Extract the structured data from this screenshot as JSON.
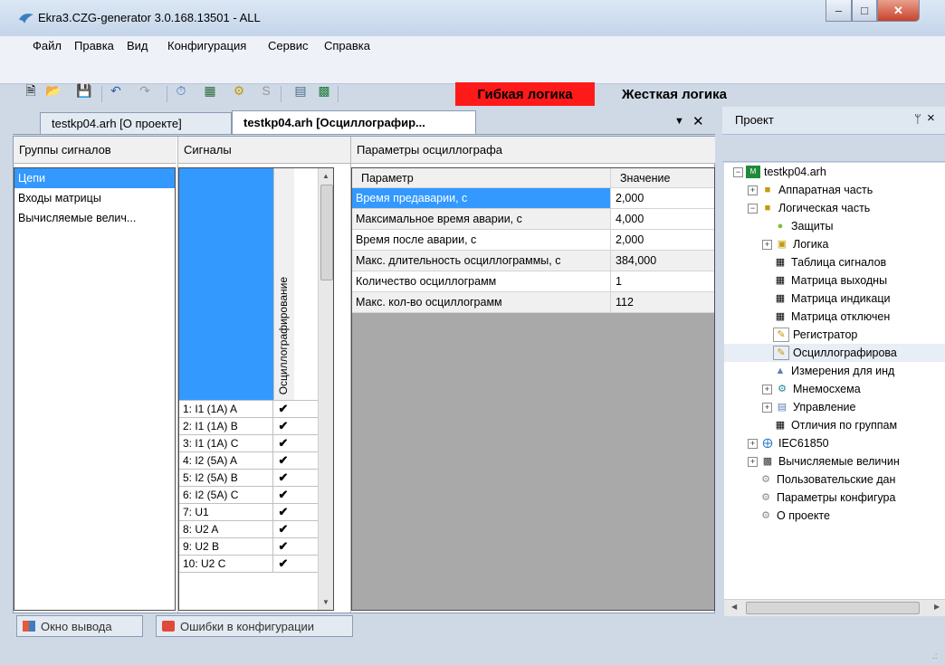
{
  "window": {
    "title": "Ekra3.CZG-generator 3.0.168.13501 - ALL"
  },
  "menu": [
    "Файл",
    "Правка",
    "Вид",
    "Конфигурация",
    "Сервис",
    "Справка"
  ],
  "toolbar": {
    "flex_logic": "Гибкая логика",
    "hard_logic": "Жесткая логика",
    "colors": {
      "flex_bg": "#ff1a1a"
    }
  },
  "tabs": [
    {
      "label": "testkp04.arh [О проекте]"
    },
    {
      "label": "testkp04.arh [Осциллографир..."
    }
  ],
  "groups": {
    "header": "Группы сигналов",
    "items": [
      "Цепи",
      "Входы матрицы",
      "Вычисляемые велич..."
    ]
  },
  "signals": {
    "header": "Сигналы",
    "column": "Осциллографирование",
    "rows": [
      {
        "name": "1: I1 (1A) A",
        "checked": "✔"
      },
      {
        "name": "2: I1 (1A) B",
        "checked": "✔"
      },
      {
        "name": "3: I1 (1A) C",
        "checked": "✔"
      },
      {
        "name": "4: I2 (5A) A",
        "checked": "✔"
      },
      {
        "name": "5: I2 (5A) B",
        "checked": "✔"
      },
      {
        "name": "6: I2 (5A) C",
        "checked": "✔"
      },
      {
        "name": "7: U1",
        "checked": "✔"
      },
      {
        "name": "8: U2 A",
        "checked": "✔"
      },
      {
        "name": "9: U2 B",
        "checked": "✔"
      },
      {
        "name": "10: U2 C",
        "checked": "✔"
      }
    ]
  },
  "params": {
    "header": "Параметры осциллографа",
    "col_param": "Параметр",
    "col_value": "Значение",
    "rows": [
      {
        "name": "Время предаварии, с",
        "value": "2,000"
      },
      {
        "name": "Максимальное время аварии, с",
        "value": "4,000"
      },
      {
        "name": "Время после аварии, с",
        "value": "2,000"
      },
      {
        "name": "Макс. длительность осциллограммы, с",
        "value": "384,000"
      },
      {
        "name": "Количество осциллограмм",
        "value": "1"
      },
      {
        "name": "Макс. кол-во осциллограмм",
        "value": "112"
      }
    ]
  },
  "project": {
    "header": "Проект",
    "pin": "ᛘ",
    "close": "×",
    "root": "testkp04.arh",
    "nodes": [
      {
        "label": "Аппаратная часть"
      },
      {
        "label": "Логическая часть"
      },
      {
        "label": "Защиты"
      },
      {
        "label": "Логика"
      },
      {
        "label": "Таблица сигналов"
      },
      {
        "label": "Матрица выходны"
      },
      {
        "label": "Матрица индикаци"
      },
      {
        "label": "Матрица отключен"
      },
      {
        "label": "Регистратор"
      },
      {
        "label": "Осциллографирова"
      },
      {
        "label": "Измерения для инд"
      },
      {
        "label": "Мнемосхема"
      },
      {
        "label": "Управление"
      },
      {
        "label": "Отличия по группам"
      },
      {
        "label": "IEC61850"
      },
      {
        "label": "Вычисляемые величин"
      },
      {
        "label": "Пользовательские дан"
      },
      {
        "label": "Параметры конфигура"
      },
      {
        "label": "О проекте"
      }
    ]
  },
  "bottom_tabs": [
    "Окно вывода",
    "Ошибки в конфигурации"
  ]
}
